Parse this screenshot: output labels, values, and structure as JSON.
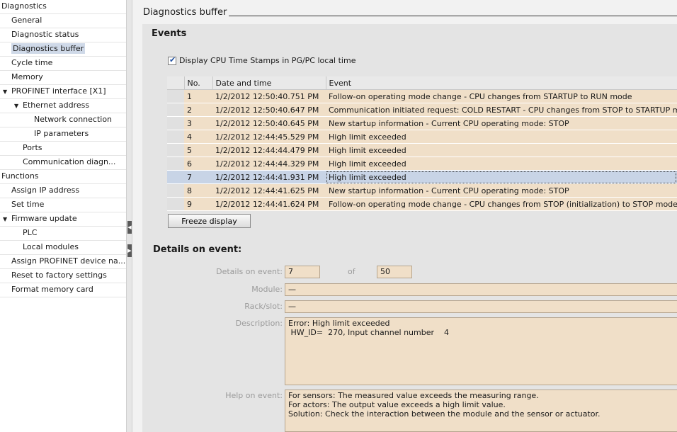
{
  "nav": {
    "items": [
      {
        "label": "Diagnostics",
        "level": 0,
        "tri": ""
      },
      {
        "label": "General",
        "level": 1,
        "tri": ""
      },
      {
        "label": "Diagnostic status",
        "level": 1,
        "tri": ""
      },
      {
        "label": "Diagnostics buffer",
        "level": 1,
        "tri": "",
        "selected": true
      },
      {
        "label": "Cycle time",
        "level": 1,
        "tri": ""
      },
      {
        "label": "Memory",
        "level": 1,
        "tri": ""
      },
      {
        "label": "PROFINET interface [X1]",
        "level": 1,
        "tri": "▼"
      },
      {
        "label": "Ethernet address",
        "level": 2,
        "tri": "▼"
      },
      {
        "label": "Network connection",
        "level": 3,
        "tri": ""
      },
      {
        "label": "IP parameters",
        "level": 3,
        "tri": ""
      },
      {
        "label": "Ports",
        "level": 2,
        "tri": ""
      },
      {
        "label": "Communication diagn...",
        "level": 2,
        "tri": ""
      },
      {
        "label": "Functions",
        "level": 0,
        "tri": ""
      },
      {
        "label": "Assign IP address",
        "level": 1,
        "tri": ""
      },
      {
        "label": "Set time",
        "level": 1,
        "tri": ""
      },
      {
        "label": "Firmware update",
        "level": 1,
        "tri": "▼"
      },
      {
        "label": "PLC",
        "level": 2,
        "tri": ""
      },
      {
        "label": "Local modules",
        "level": 2,
        "tri": ""
      },
      {
        "label": "Assign PROFINET device na...",
        "level": 1,
        "tri": ""
      },
      {
        "label": "Reset to factory settings",
        "level": 1,
        "tri": ""
      },
      {
        "label": "Format memory card",
        "level": 1,
        "tri": ""
      }
    ]
  },
  "section_title": "Diagnostics buffer",
  "events": {
    "title": "Events",
    "timestamp_checkbox_label": "Display CPU Time Stamps in PG/PC local time",
    "timestamp_checked": true,
    "columns": [
      "No.",
      "Date and time",
      "Event"
    ],
    "rows": [
      {
        "no": "1",
        "time": "1/2/2012 12:50:40.751 PM",
        "event": "Follow-on operating mode change  - CPU changes from STARTUP to RUN mode"
      },
      {
        "no": "2",
        "time": "1/2/2012 12:50:40.647 PM",
        "event": "Communication initiated request: COLD RESTART  - CPU changes from STOP to STARTUP mode"
      },
      {
        "no": "3",
        "time": "1/2/2012 12:50:40.645 PM",
        "event": "New startup information  - Current CPU operating mode: STOP"
      },
      {
        "no": "4",
        "time": "1/2/2012 12:44:45.529 PM",
        "event": "High limit exceeded"
      },
      {
        "no": "5",
        "time": "1/2/2012 12:44:44.479 PM",
        "event": "High limit exceeded"
      },
      {
        "no": "6",
        "time": "1/2/2012 12:44:44.329 PM",
        "event": "High limit exceeded"
      },
      {
        "no": "7",
        "time": "1/2/2012 12:44:41.931 PM",
        "event": "High limit exceeded",
        "selected": true
      },
      {
        "no": "8",
        "time": "1/2/2012 12:44:41.625 PM",
        "event": "New startup information  - Current CPU operating mode: STOP"
      },
      {
        "no": "9",
        "time": "1/2/2012 12:44:41.624 PM",
        "event": "Follow-on operating mode change  - CPU changes from STOP (initialization) to STOP mode"
      }
    ],
    "freeze_button": "Freeze display"
  },
  "details": {
    "title": "Details on event:",
    "event_label": "Details on event:",
    "event_number": "7",
    "of_label": "of",
    "total_events": "50",
    "module_label": "Module:",
    "module_value": "—",
    "rack_label": "Rack/slot:",
    "rack_value": "—",
    "description_label": "Description:",
    "description_value": "Error: High limit exceeded\n HW_ID=  270, Input channel number    4",
    "help_label": "Help on event:",
    "help_value": "For sensors: The measured value exceeds the measuring range.\nFor actors: The output value exceeds a high limit value.\nSolution: Check the interaction between the module and the sensor or actuator."
  },
  "colors": {
    "field_bg": "#f0dfc8",
    "selection_bg": "#c8d4e6",
    "panel_bg": "#e4e4e4"
  }
}
